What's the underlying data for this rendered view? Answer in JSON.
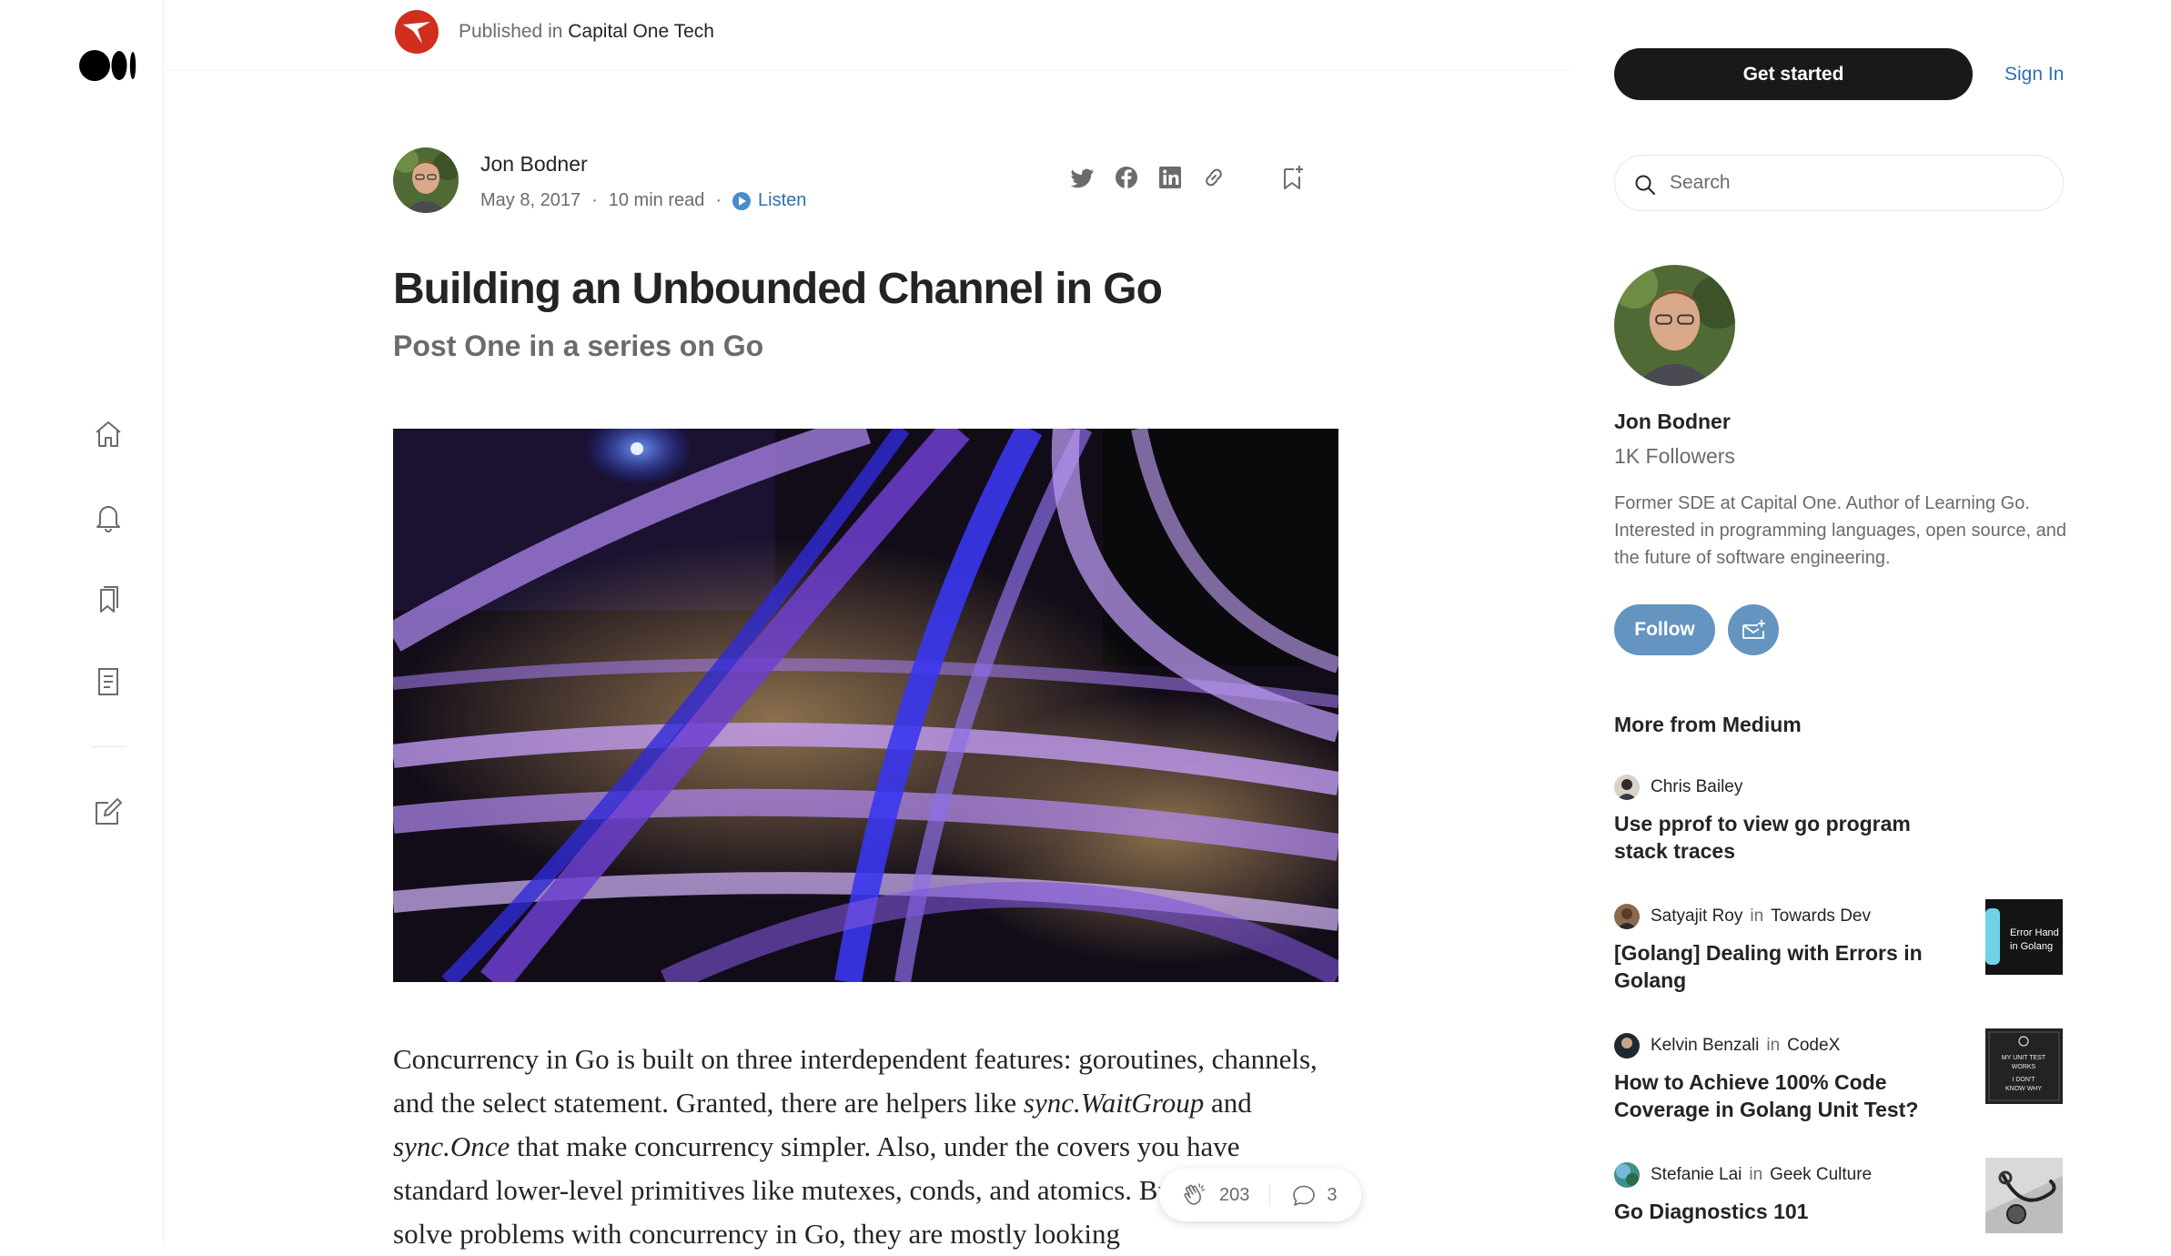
{
  "publication": {
    "prefix": "Published in",
    "name": "Capital One Tech"
  },
  "article": {
    "author": "Jon Bodner",
    "date": "May 8, 2017",
    "read_time": "10 min read",
    "dot": "·",
    "listen_label": "Listen",
    "title": "Building an Unbounded Channel in Go",
    "subtitle": "Post One in a series on Go",
    "body": {
      "p1": "Concurrency in Go is built on three interdependent features: goroutines, channels, and the select statement. Granted, there are helpers like ",
      "em1": "sync.WaitGroup",
      "p2": " and ",
      "em2": "sync.Once",
      "p3": " that make concurrency simpler. Also, under the covers you have standard lower-level primitives like mutexes, conds, and atomics. But when people solve problems with concurrency in Go, they are mostly looking"
    },
    "claps": "203",
    "responses": "3"
  },
  "sidebar": {
    "get_started": "Get started",
    "sign_in": "Sign In",
    "search_placeholder": "Search",
    "author_name": "Jon Bodner",
    "followers": "1K Followers",
    "bio": "Former SDE at Capital One. Author of Learning Go. Interested in programming languages, open source, and the future of software engineering.",
    "follow": "Follow",
    "more_heading": "More from Medium",
    "in_label": "in",
    "recommendations": [
      {
        "author": "Chris Bailey",
        "publication": "",
        "title": "Use pprof to view go program stack traces"
      },
      {
        "author": "Satyajit Roy",
        "publication": "Towards Dev",
        "title": "[Golang] Dealing with Errors in Golang",
        "thumb_text": "Error Hand in Golang"
      },
      {
        "author": "Kelvin Benzali",
        "publication": "CodeX",
        "title": "How to Achieve 100% Code Coverage in Golang Unit Test?",
        "thumb_text": "MY UNIT TEST WORKS I DON'T KNOW WHY"
      },
      {
        "author": "Stefanie Lai",
        "publication": "Geek Culture",
        "title": "Go Diagnostics 101"
      }
    ]
  },
  "colors": {
    "accent_blue": "#2e6fb0",
    "follow_blue": "#6494c0",
    "dark_button": "#191919",
    "publication_red": "#d22e1e"
  },
  "icons": [
    "medium-logo-icon",
    "home-icon",
    "bell-icon",
    "bookmarks-icon",
    "stories-icon",
    "write-icon",
    "twitter-icon",
    "facebook-icon",
    "linkedin-icon",
    "link-icon",
    "bookmark-add-icon",
    "play-icon",
    "clap-icon",
    "comment-icon",
    "search-icon",
    "mail-plus-icon"
  ]
}
